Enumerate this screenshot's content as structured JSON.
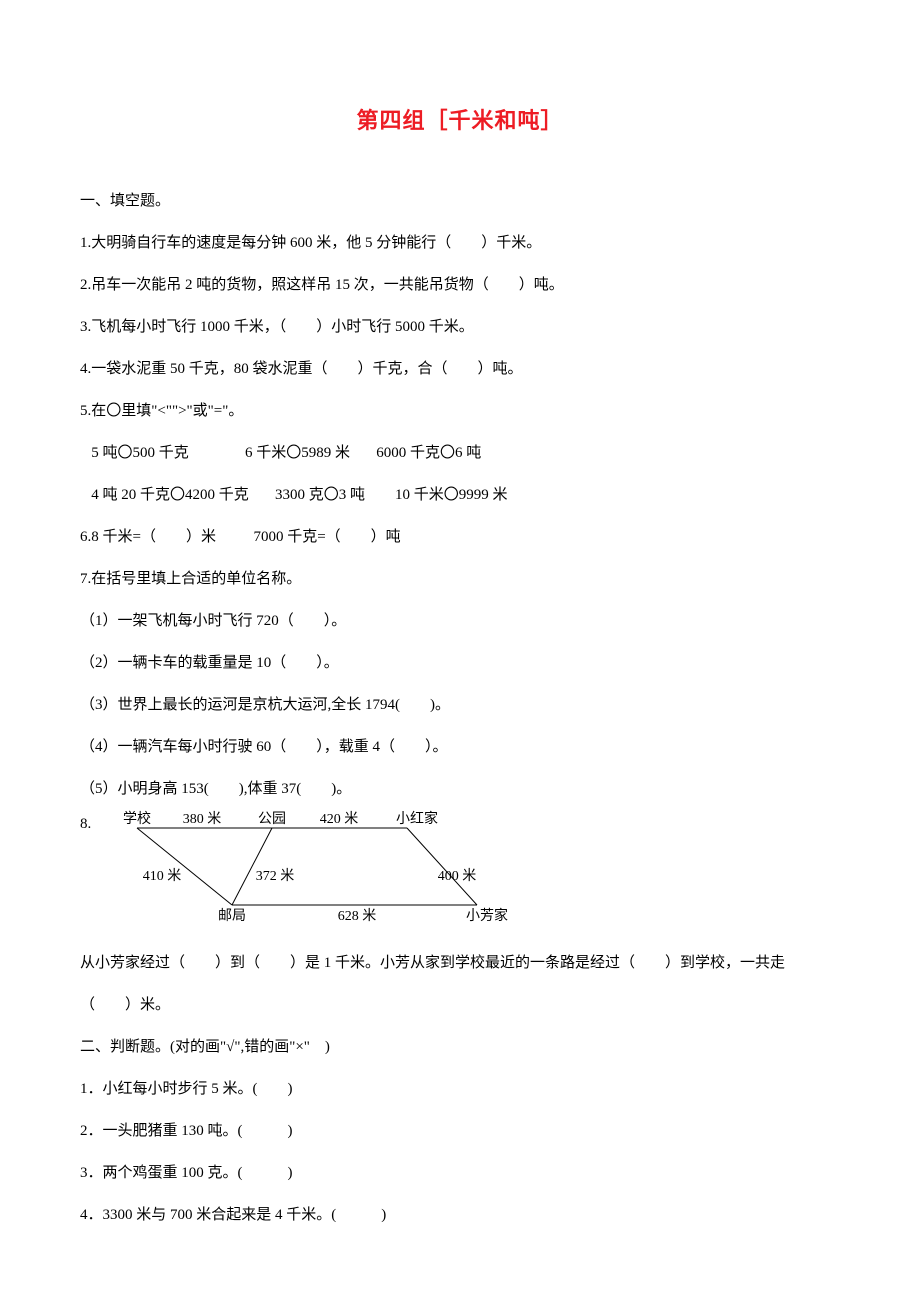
{
  "title": "第四组［千米和吨］",
  "secA": "一、填空题。",
  "q1": "1.大明骑自行车的速度是每分钟 600 米，他 5 分钟能行（　　）千米。",
  "q2": "2.吊车一次能吊 2 吨的货物，照这样吊 15 次，一共能吊货物（　　）吨。",
  "q3": "3.飞机每小时飞行 1000 千米，（　　）小时飞行 5000 千米。",
  "q4": "4.一袋水泥重 50 千克，80 袋水泥重（　　）千克，合（　　）吨。",
  "q5Head": "5.在〇里填\"<\"\">\"或\"=\"。",
  "q5a": "   5 吨〇500 千克               6 千米〇5989 米       6000 千克〇6 吨",
  "q5b": "   4 吨 20 千克〇4200 千克       3300 克〇3 吨        10 千米〇9999 米",
  "q6": "6.8 千米=（　　）米          7000 千克=（　　）吨",
  "q7Head": "7.在括号里填上合适的单位名称。",
  "q7_1": "（1）一架飞机每小时飞行 720（　　）。",
  "q7_2": "（2）一辆卡车的载重量是 10（　　）。",
  "q7_3": "（3）世界上最长的运河是京杭大运河,全长 1794(　　)。",
  "q7_4": "（4）一辆汽车每小时行驶 60（　　），载重 4（　　）。",
  "q7_5": "（5）小明身高 153(　　),体重 37(　　)。",
  "q8num": "8.",
  "q8text": "从小芳家经过（　　）到（　　）是 1 千米。小芳从家到学校最近的一条路是经过（　　）到学校，一共走",
  "q8text2": "（　　）米。",
  "svg": {
    "school": "学校",
    "park": "公园",
    "xiaohong": "小红家",
    "xiaofang": "小芳家",
    "post": "邮局",
    "d380": "380 米",
    "d420": "420 米",
    "d410": "410 米",
    "d372": "372 米",
    "d400": "400 米",
    "d628": "628 米"
  },
  "secB": "二、判断题。(对的画\"√\",错的画\"×\"　)",
  "b1": "1．小红每小时步行 5 米。(　　)",
  "b2": "2．一头肥猪重 130 吨。(　　　)",
  "b3": "3．两个鸡蛋重 100 克。(　　　)",
  "b4": "4．3300 米与 700 米合起来是 4 千米。(　　　)"
}
